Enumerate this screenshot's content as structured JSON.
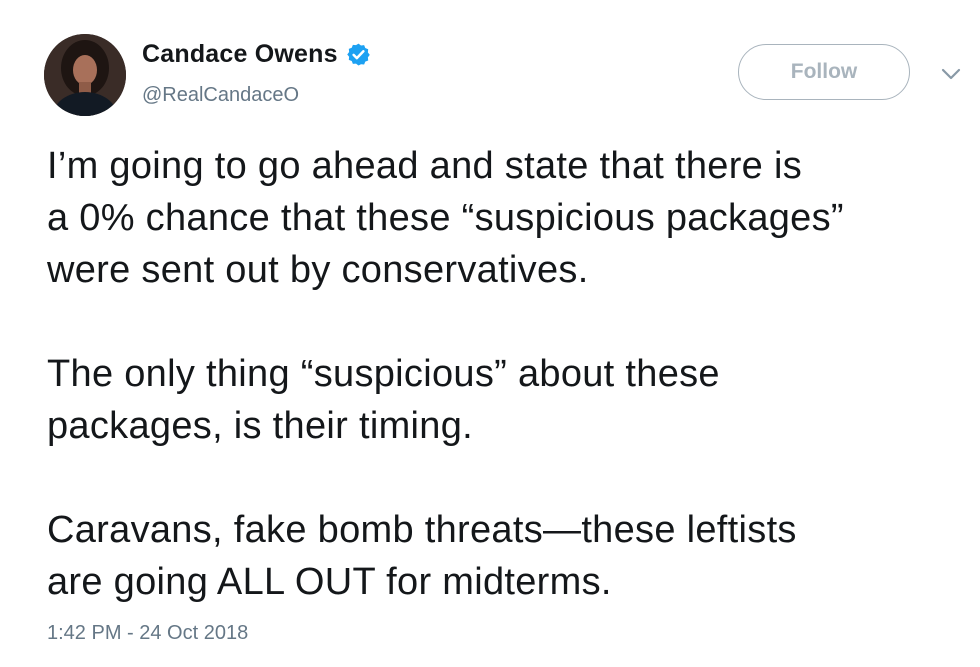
{
  "author": {
    "display_name": "Candace Owens",
    "handle": "@RealCandaceO",
    "verified": true,
    "avatar_icon": "profile-photo"
  },
  "actions": {
    "follow_label": "Follow",
    "menu_icon": "chevron-down-icon"
  },
  "tweet": {
    "paragraphs": [
      {
        "lines": [
          "I’m going to go ahead and state that there is",
          "a 0% chance that these “suspicious packages”",
          "were sent out by conservatives."
        ]
      },
      {
        "lines": [
          "The only thing “suspicious” about these",
          "packages, is their timing."
        ]
      },
      {
        "lines": [
          "Caravans, fake bomb threats—these leftists",
          "are going ALL OUT for midterms."
        ]
      }
    ],
    "timestamp": "1:42 PM - 24 Oct 2018"
  },
  "colors": {
    "text": "#14171a",
    "secondary": "#657786",
    "verified_badge": "#1da1f2",
    "follow_border": "#a9b4bd"
  }
}
